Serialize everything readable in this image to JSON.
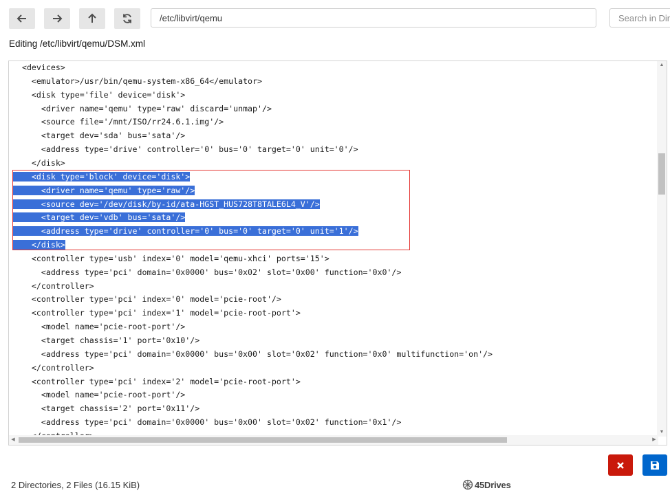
{
  "toolbar": {
    "back_icon": "arrow-left-icon",
    "forward_icon": "arrow-right-icon",
    "up_icon": "arrow-up-icon",
    "refresh_icon": "refresh-icon",
    "path_value": "/etc/libvirt/qemu",
    "search_placeholder": "Search in Dir"
  },
  "editor": {
    "title": "Editing /etc/libvirt/qemu/DSM.xml",
    "lines": [
      {
        "indent": "  ",
        "text": "<devices>"
      },
      {
        "indent": "    ",
        "text": "<emulator>/usr/bin/qemu-system-x86_64</emulator>"
      },
      {
        "indent": "    ",
        "text": "<disk type='file' device='disk'>"
      },
      {
        "indent": "      ",
        "text": "<driver name='qemu' type='raw' discard='unmap'/>"
      },
      {
        "indent": "      ",
        "text": "<source file='/mnt/ISO/rr24.6.1.img'/>"
      },
      {
        "indent": "      ",
        "text": "<target dev='sda' bus='sata'/>"
      },
      {
        "indent": "      ",
        "text": "<address type='drive' controller='0' bus='0' target='0' unit='0'/>"
      },
      {
        "indent": "    ",
        "text": "</disk>"
      },
      {
        "indent": "    ",
        "text": "<disk type='block' device='disk'>"
      },
      {
        "indent": "      ",
        "text": "<driver name='qemu' type='raw'/>"
      },
      {
        "indent": "      ",
        "text": "<source dev='/dev/disk/by-id/ata-HGST_HUS728T8TALE6L4_V'/>"
      },
      {
        "indent": "      ",
        "text": "<target dev='vdb' bus='sata'/>"
      },
      {
        "indent": "      ",
        "text": "<address type='drive' controller='0' bus='0' target='0' unit='1'/>"
      },
      {
        "indent": "    ",
        "text": "</disk>"
      },
      {
        "indent": "    ",
        "text": "<controller type='usb' index='0' model='qemu-xhci' ports='15'>"
      },
      {
        "indent": "      ",
        "text": "<address type='pci' domain='0x0000' bus='0x02' slot='0x00' function='0x0'/>"
      },
      {
        "indent": "    ",
        "text": "</controller>"
      },
      {
        "indent": "    ",
        "text": "<controller type='pci' index='0' model='pcie-root'/>"
      },
      {
        "indent": "    ",
        "text": "<controller type='pci' index='1' model='pcie-root-port'>"
      },
      {
        "indent": "      ",
        "text": "<model name='pcie-root-port'/>"
      },
      {
        "indent": "      ",
        "text": "<target chassis='1' port='0x10'/>"
      },
      {
        "indent": "      ",
        "text": "<address type='pci' domain='0x0000' bus='0x00' slot='0x02' function='0x0' multifunction='on'/>"
      },
      {
        "indent": "    ",
        "text": "</controller>"
      },
      {
        "indent": "    ",
        "text": "<controller type='pci' index='2' model='pcie-root-port'>"
      },
      {
        "indent": "      ",
        "text": "<model name='pcie-root-port'/>"
      },
      {
        "indent": "      ",
        "text": "<target chassis='2' port='0x11'/>"
      },
      {
        "indent": "      ",
        "text": "<address type='pci' domain='0x0000' bus='0x00' slot='0x02' function='0x1'/>"
      },
      {
        "indent": "    ",
        "text": "</controller>"
      }
    ],
    "selected_lines": [
      8,
      9,
      10,
      11,
      12,
      13
    ]
  },
  "actions": {
    "cancel_icon": "close-icon",
    "save_icon": "save-icon",
    "cancel_color": "#c9190b",
    "save_color": "#0066cc"
  },
  "status": {
    "text": "2 Directories, 2 Files (16.15 KiB)"
  },
  "brand": {
    "name": "45Drives",
    "icon": "45drives-logo-icon"
  },
  "colors": {
    "selection": "#3a6fd8",
    "selection_outline": "#e53935"
  }
}
